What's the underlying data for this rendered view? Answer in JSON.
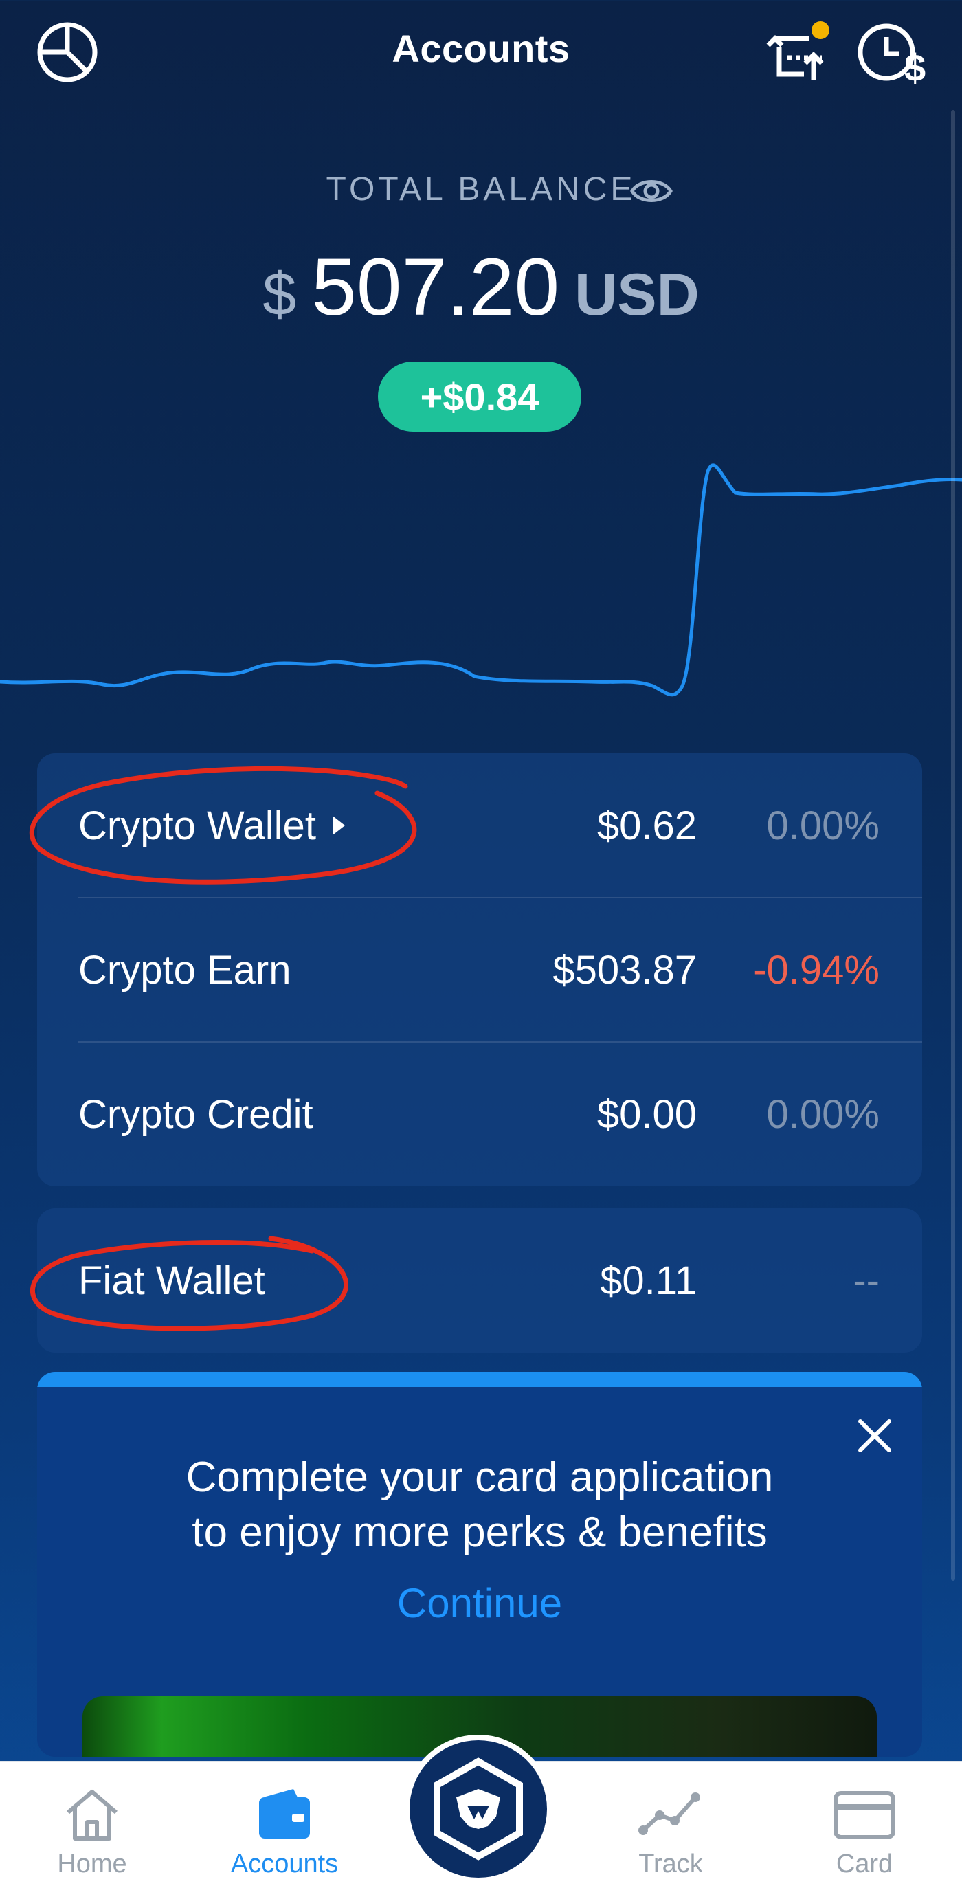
{
  "header": {
    "title": "Accounts",
    "left_icon": "portfolio-pie-icon",
    "right_icons": [
      "transfer-icon",
      "history-icon"
    ],
    "notification_dot_color": "#f5b400"
  },
  "balance": {
    "label": "TOTAL BALANCE",
    "currency_symbol": "$",
    "amount": "507.20",
    "currency_code": "USD",
    "change": "+$0.84",
    "change_color": "#1ec29a"
  },
  "accounts": [
    {
      "name": "Crypto Wallet",
      "value": "$0.62",
      "change": "0.00%"
    },
    {
      "name": "Crypto Earn",
      "value": "$503.87",
      "change": "-0.94%"
    },
    {
      "name": "Crypto Credit",
      "value": "$0.00",
      "change": "0.00%"
    }
  ],
  "fiat": {
    "name": "Fiat Wallet",
    "value": "$0.11",
    "change": "--"
  },
  "promo": {
    "line1": "Complete your card application",
    "line2": "to enjoy more perks & benefits",
    "cta": "Continue"
  },
  "nav": {
    "items": [
      {
        "label": "Home",
        "icon": "home-icon"
      },
      {
        "label": "Accounts",
        "icon": "wallet-icon"
      },
      {
        "label": "Track",
        "icon": "chart-line-icon"
      },
      {
        "label": "Card",
        "icon": "card-icon"
      }
    ],
    "active": "Accounts",
    "accent": "#1f8ef1"
  }
}
